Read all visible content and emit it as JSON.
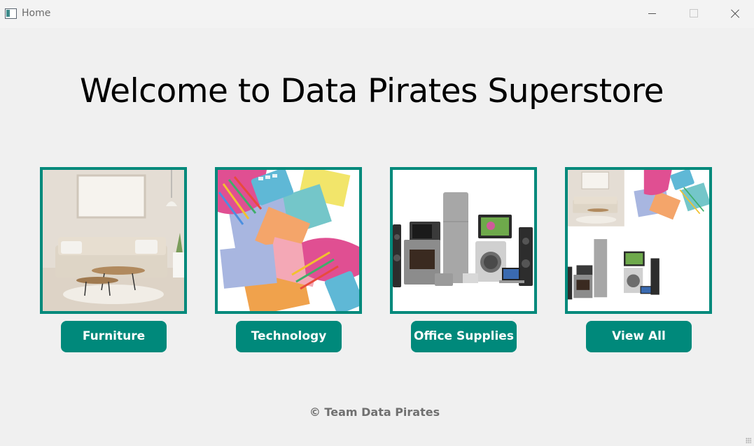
{
  "window": {
    "title": "Home"
  },
  "main": {
    "heading": "Welcome to Data Pirates Superstore"
  },
  "categories": [
    {
      "label": "Furniture"
    },
    {
      "label": "Technology"
    },
    {
      "label": "Office Supplies"
    },
    {
      "label": "View All"
    }
  ],
  "footer": {
    "text": "© Team Data Pirates"
  },
  "colors": {
    "accent": "#00897b",
    "background": "#f0f0f0",
    "footer_text": "#707070"
  }
}
